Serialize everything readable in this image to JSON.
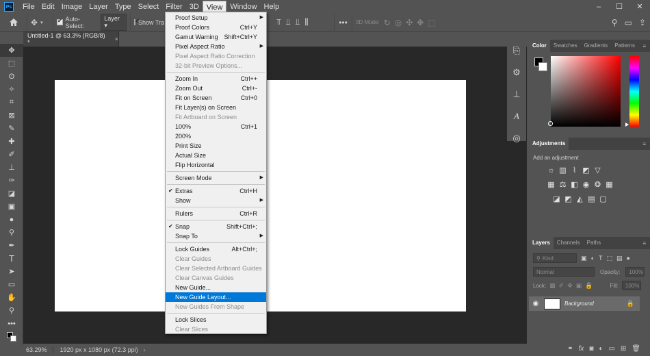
{
  "menubar": {
    "logo": "Ps",
    "items": [
      "File",
      "Edit",
      "Image",
      "Layer",
      "Type",
      "Select",
      "Filter",
      "3D",
      "View",
      "Window",
      "Help"
    ],
    "active_index": 8,
    "window_controls": [
      "–",
      "☐",
      "✕"
    ]
  },
  "options_bar": {
    "auto_select_label": "Auto-Select:",
    "auto_select_target": "Layer",
    "show_transform_label": "Show Tra",
    "mode_3d_label": "3D Mode:"
  },
  "document": {
    "tab_title": "Untitled-1 @ 63.3% (RGB/8) *",
    "close_glyph": "×"
  },
  "status_bar": {
    "zoom": "63.29%",
    "info": "1920 px x 1080 px (72.3 ppi)"
  },
  "view_menu": {
    "items": [
      {
        "label": "Proof Setup",
        "shortcut": "",
        "submenu": true,
        "disabled": false
      },
      {
        "label": "Proof Colors",
        "shortcut": "Ctrl+Y",
        "disabled": false
      },
      {
        "label": "Gamut Warning",
        "shortcut": "Shift+Ctrl+Y",
        "disabled": false
      },
      {
        "label": "Pixel Aspect Ratio",
        "shortcut": "",
        "submenu": true,
        "disabled": false
      },
      {
        "label": "Pixel Aspect Ratio Correction",
        "shortcut": "",
        "disabled": true
      },
      {
        "label": "32-bit Preview Options...",
        "shortcut": "",
        "disabled": true
      },
      {
        "label": "Zoom In",
        "shortcut": "Ctrl++",
        "disabled": false
      },
      {
        "label": "Zoom Out",
        "shortcut": "Ctrl+-",
        "disabled": false
      },
      {
        "label": "Fit on Screen",
        "shortcut": "Ctrl+0",
        "disabled": false
      },
      {
        "label": "Fit Layer(s) on Screen",
        "shortcut": "",
        "disabled": false
      },
      {
        "label": "Fit Artboard on Screen",
        "shortcut": "",
        "disabled": true
      },
      {
        "label": "100%",
        "shortcut": "Ctrl+1",
        "disabled": false
      },
      {
        "label": "200%",
        "shortcut": "",
        "disabled": false
      },
      {
        "label": "Print Size",
        "shortcut": "",
        "disabled": false
      },
      {
        "label": "Actual Size",
        "shortcut": "",
        "disabled": false
      },
      {
        "label": "Flip Horizontal",
        "shortcut": "",
        "disabled": false
      },
      {
        "label": "Screen Mode",
        "shortcut": "",
        "submenu": true,
        "disabled": false
      },
      {
        "label": "Extras",
        "shortcut": "Ctrl+H",
        "checked": true,
        "disabled": false
      },
      {
        "label": "Show",
        "shortcut": "",
        "submenu": true,
        "disabled": false
      },
      {
        "label": "Rulers",
        "shortcut": "Ctrl+R",
        "disabled": false
      },
      {
        "label": "Snap",
        "shortcut": "Shift+Ctrl+;",
        "checked": true,
        "disabled": false
      },
      {
        "label": "Snap To",
        "shortcut": "",
        "submenu": true,
        "disabled": false
      },
      {
        "label": "Lock Guides",
        "shortcut": "Alt+Ctrl+;",
        "disabled": false
      },
      {
        "label": "Clear Guides",
        "shortcut": "",
        "disabled": true
      },
      {
        "label": "Clear Selected Artboard Guides",
        "shortcut": "",
        "disabled": true
      },
      {
        "label": "Clear Canvas Guides",
        "shortcut": "",
        "disabled": true
      },
      {
        "label": "New Guide...",
        "shortcut": "",
        "disabled": false
      },
      {
        "label": "New Guide Layout...",
        "shortcut": "",
        "disabled": false,
        "highlighted": true
      },
      {
        "label": "New Guides From Shape",
        "shortcut": "",
        "disabled": true
      },
      {
        "label": "Lock Slices",
        "shortcut": "",
        "disabled": false
      },
      {
        "label": "Clear Slices",
        "shortcut": "",
        "disabled": true
      }
    ]
  },
  "color_panel": {
    "tabs": [
      "Color",
      "Swatches",
      "Gradients",
      "Patterns"
    ],
    "active_tab": 0,
    "foreground": "#000000",
    "background": "#ffffff"
  },
  "adjustments_panel": {
    "tab": "Adjustments",
    "hint": "Add an adjustment"
  },
  "layers_panel": {
    "tabs": [
      "Layers",
      "Channels",
      "Paths"
    ],
    "active_tab": 0,
    "filter_label": "Kind",
    "blend_mode": "Normal",
    "opacity_label": "Opacity:",
    "opacity_value": "100%",
    "lock_label": "Lock:",
    "fill_label": "Fill:",
    "fill_value": "100%",
    "layer_name": "Background"
  },
  "accent_color": "#0078d7"
}
